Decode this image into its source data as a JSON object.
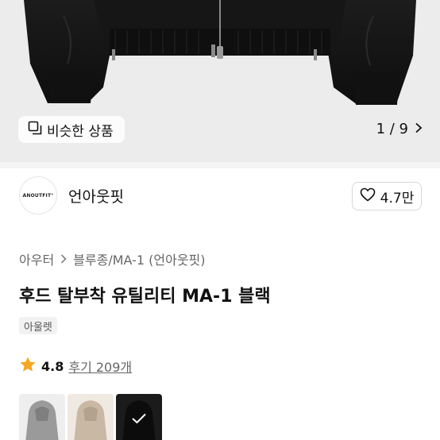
{
  "gallery": {
    "similar_label": "비슷한 상품",
    "counter": "1 / 9"
  },
  "brand": {
    "logo_text": "ANOUTFIT°",
    "name": "언아웃핏",
    "like_count": "4.7만"
  },
  "breadcrumb": [
    "아우터",
    "블루종/MA-1 (언아웃핏)"
  ],
  "product": {
    "title": "후드 탈부착 유틸리티 MA-1 블랙",
    "tag": "아울렛",
    "rating": "4.8",
    "review_label": "후기 209개"
  },
  "colors": {
    "star": "#f5a623",
    "hero_bg": "#ececec"
  },
  "swatches": [
    {
      "name": "grey",
      "selected": false
    },
    {
      "name": "beige",
      "selected": false
    },
    {
      "name": "black",
      "selected": true
    }
  ]
}
